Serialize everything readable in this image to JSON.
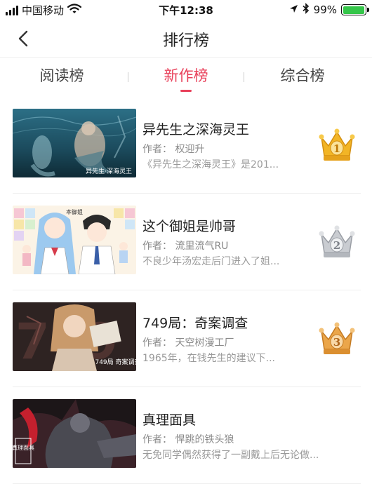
{
  "status_bar": {
    "carrier": "中国移动",
    "time": "下午12:38",
    "battery": "99%",
    "battery_level": 0.99,
    "icons": [
      "signal-icon",
      "wifi-icon",
      "location-icon",
      "bluetooth-icon",
      "battery-icon"
    ]
  },
  "nav": {
    "title": "排行榜",
    "back_icon": "chevron-left-icon"
  },
  "tabs": [
    {
      "label": "阅读榜",
      "active": false
    },
    {
      "label": "新作榜",
      "active": true
    },
    {
      "label": "综合榜",
      "active": false
    }
  ],
  "colors": {
    "accent": "#e8405a",
    "gold": "#f2b526",
    "silver": "#b9bcc2",
    "bronze": "#e8a03c",
    "divider": "#eeeeee",
    "secondary_text": "#8a8a8a"
  },
  "items": [
    {
      "rank": "1",
      "medal": "gold",
      "title": "异先生之深海灵王",
      "author": "作者：  权迎升",
      "desc": "《异先生之深海灵王》是201...",
      "cover_text": "异先生·深海灵王"
    },
    {
      "rank": "2",
      "medal": "silver",
      "title": "这个御姐是帅哥",
      "author": "作者：  流里流气RU",
      "desc": "不良少年汤宏走后门进入了姐...",
      "cover_text": "本御姐"
    },
    {
      "rank": "3",
      "medal": "bronze",
      "title": "749局：奇案调查",
      "author": "作者：  天空树漫工厂",
      "desc": "1965年，在钱先生的建议下...",
      "cover_text": "749局 奇案调查"
    },
    {
      "rank": "",
      "medal": "",
      "title": "真理面具",
      "author": "作者：  悍跳的铁头狼",
      "desc": "无免同学偶然获得了一副戴上后无论做...",
      "cover_text": "真理面具"
    }
  ]
}
